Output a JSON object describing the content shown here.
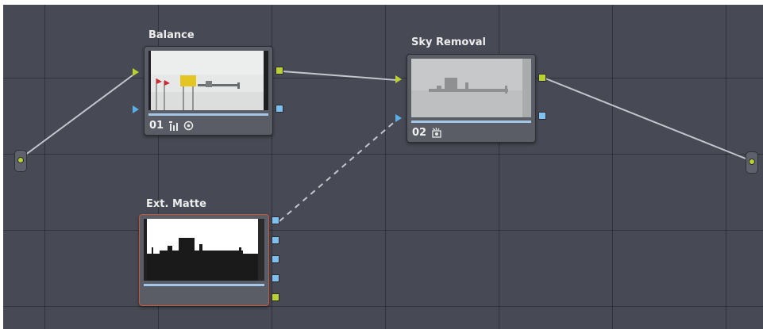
{
  "nodes": {
    "balance": {
      "label": "Balance",
      "number": "01",
      "icons": [
        "rgb-mixer-icon",
        "circle-dot-icon"
      ]
    },
    "sky_removal": {
      "label": "Sky Removal",
      "number": "02",
      "icons": [
        "key-icon"
      ]
    },
    "ext_matte": {
      "label": "Ext. Matte"
    }
  },
  "connections": [
    {
      "from": "source-input",
      "to": "balance.rgb-in",
      "style": "solid"
    },
    {
      "from": "balance.rgb-out",
      "to": "sky_removal.rgb-in",
      "style": "solid"
    },
    {
      "from": "ext_matte.output-1",
      "to": "sky_removal.key-in",
      "style": "dashed"
    },
    {
      "from": "sky_removal.rgb-out",
      "to": "output",
      "style": "solid"
    }
  ],
  "colors": {
    "canvas": "#474a55",
    "rgb_port": "#b9d232",
    "key_port": "#5aaee8",
    "selected_border": "#c4573d",
    "wire": "#c3c6cc"
  }
}
